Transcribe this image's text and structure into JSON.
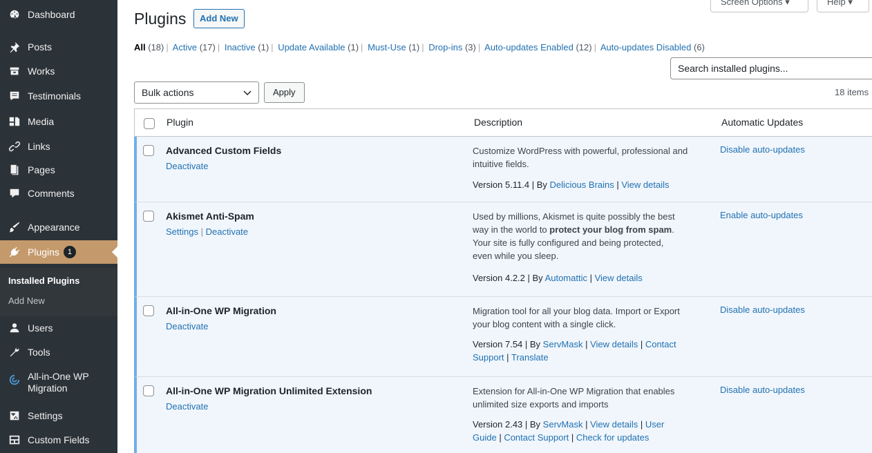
{
  "sidebar": {
    "items": [
      {
        "label": "Dashboard",
        "icon": "dashboard-icon"
      },
      {
        "label": "Posts",
        "icon": "pin-icon"
      },
      {
        "label": "Works",
        "icon": "archive-icon"
      },
      {
        "label": "Testimonials",
        "icon": "testimonial-icon"
      },
      {
        "label": "Media",
        "icon": "media-icon"
      },
      {
        "label": "Links",
        "icon": "link-icon"
      },
      {
        "label": "Pages",
        "icon": "page-icon"
      },
      {
        "label": "Comments",
        "icon": "comment-icon"
      },
      {
        "label": "Appearance",
        "icon": "brush-icon"
      },
      {
        "label": "Plugins",
        "icon": "plugin-icon",
        "badge": "1"
      },
      {
        "label": "Users",
        "icon": "users-icon"
      },
      {
        "label": "Tools",
        "icon": "wrench-icon"
      },
      {
        "label": "All-in-One WP Migration",
        "icon": "migration-icon"
      },
      {
        "label": "Settings",
        "icon": "settings-icon"
      },
      {
        "label": "Custom Fields",
        "icon": "fields-icon"
      }
    ],
    "submenu": {
      "installed": "Installed Plugins",
      "add_new": "Add New"
    }
  },
  "screen_meta": {
    "screen_options": "Screen Options ▾",
    "help": "Help ▾"
  },
  "header": {
    "title": "Plugins",
    "add_new": "Add New"
  },
  "filters": [
    {
      "label": "All",
      "count": "(18)",
      "current": true
    },
    {
      "label": "Active",
      "count": "(17)"
    },
    {
      "label": "Inactive",
      "count": "(1)"
    },
    {
      "label": "Update Available",
      "count": "(1)"
    },
    {
      "label": "Must-Use",
      "count": "(1)"
    },
    {
      "label": "Drop-ins",
      "count": "(3)"
    },
    {
      "label": "Auto-updates Enabled",
      "count": "(12)"
    },
    {
      "label": "Auto-updates Disabled",
      "count": "(6)"
    }
  ],
  "search": {
    "placeholder": "Search installed plugins..."
  },
  "bulk": {
    "selected": "Bulk actions",
    "apply": "Apply"
  },
  "items_count": "18 items",
  "table": {
    "headers": {
      "plugin": "Plugin",
      "description": "Description",
      "auto": "Automatic Updates"
    },
    "rows": [
      {
        "name": "Advanced Custom Fields",
        "actions": [
          "Deactivate"
        ],
        "desc_lines": [
          "Customize WordPress with powerful, professional and",
          "intuitive fields."
        ],
        "version": "Version 5.11.4 | By ",
        "author": "Delicious Brains",
        "links": [
          "View details"
        ],
        "auto": "Disable auto-updates"
      },
      {
        "name": "Akismet Anti-Spam",
        "actions": [
          "Settings",
          "Deactivate"
        ],
        "desc_lines": [
          "Used by millions, Akismet is quite possibly the best",
          "way in the world to ",
          "protect your blog from spam",
          ".",
          "Your site is fully configured and being protected,",
          "even while you sleep."
        ],
        "version": "Version 4.2.2 | By ",
        "author": "Automattic",
        "links": [
          "View details"
        ],
        "auto": "Enable auto-updates"
      },
      {
        "name": "All-in-One WP Migration",
        "actions": [
          "Deactivate"
        ],
        "desc_lines": [
          "Migration tool for all your blog data. Import or Export",
          "your blog content with a single click."
        ],
        "version": "Version 7.54 | By ",
        "author": "ServMask",
        "links": [
          "View details",
          "Contact",
          "Support",
          "Translate"
        ],
        "auto": "Disable auto-updates"
      },
      {
        "name": "All-in-One WP Migration Unlimited Extension",
        "actions": [
          "Deactivate"
        ],
        "desc_lines": [
          "Extension for All-in-One WP Migration that enables",
          "unlimited size exports and imports"
        ],
        "version": "Version 2.43 | By ",
        "author": "ServMask",
        "links": [
          "View details",
          "User",
          "Guide",
          "Contact Support",
          "Check for updates"
        ],
        "auto": "Disable auto-updates"
      }
    ]
  }
}
